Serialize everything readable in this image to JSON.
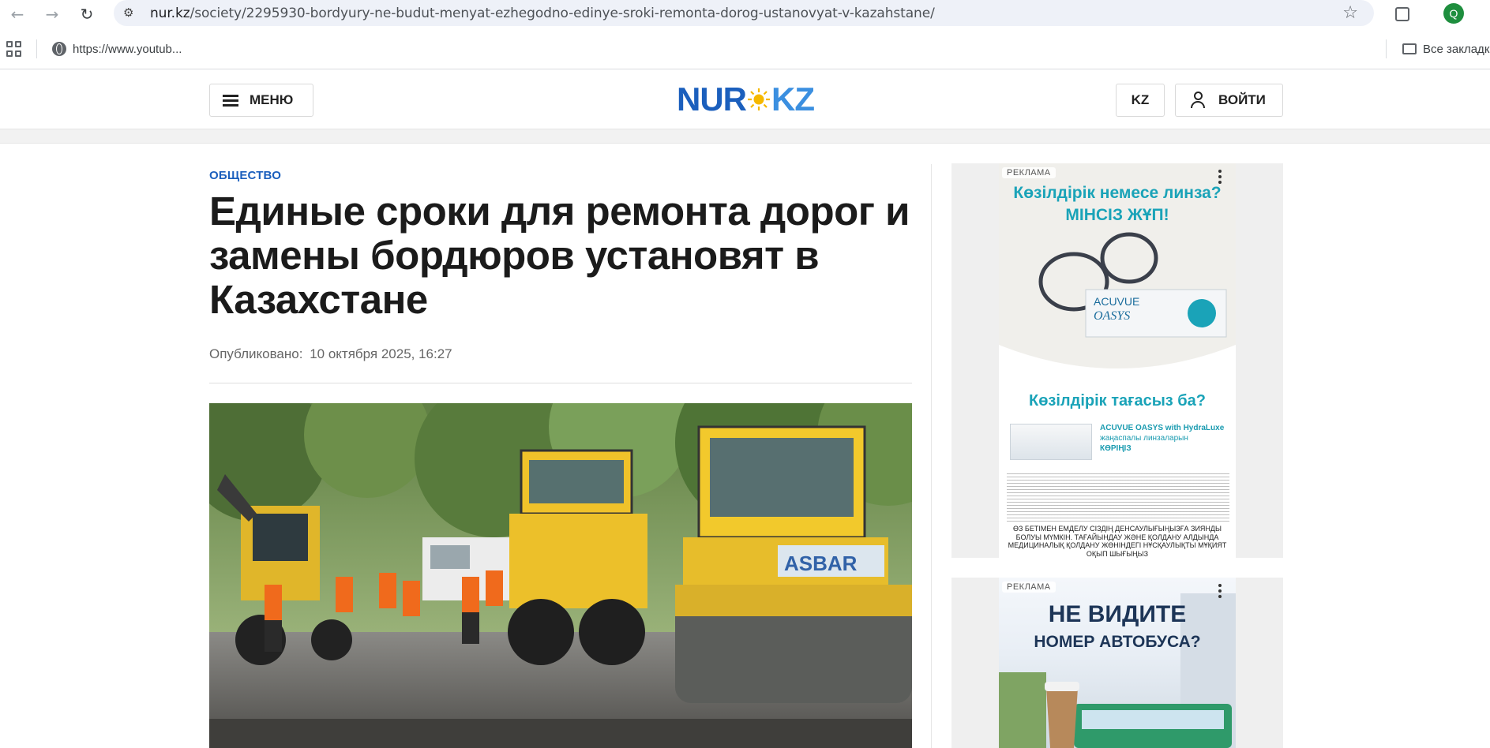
{
  "browser": {
    "url_domain": "nur.kz",
    "url_path": "/society/2295930-bordyury-ne-budut-menyat-ezhegodno-edinye-sroki-remonta-dorog-ustanovyat-v-kazahstane/",
    "profile_initial": "Q",
    "bookmarks": [
      {
        "label": "https://www.youtub..."
      }
    ],
    "all_bookmarks_label": "Все закладк"
  },
  "header": {
    "menu_label": "МЕНЮ",
    "logo_left": "NUR",
    "logo_right": "KZ",
    "lang_label": "KZ",
    "login_label": "ВОЙТИ"
  },
  "article": {
    "category": "ОБЩЕСТВО",
    "title": "Единые сроки для ремонта дорог и замены бордюров установят в Казахстане",
    "published_label": "Опубликовано:",
    "published_date": "10 октября 2025, 16:27",
    "roller_sign": "ASBAR"
  },
  "ads": [
    {
      "tag": "РЕКЛАМА",
      "headline_1": "Көзілдірік немесе линза?",
      "headline_2": "МІНСІЗ ЖҰП!",
      "question": "Көзілдірік тағасыз ба?",
      "product_name": "ACUVUE OASYS with HydraLuxe",
      "product_desc": "жаңаспалы линзаларын",
      "product_cta": "КӨРІҢІЗ",
      "box_brand": "ACUVUE",
      "box_line": "OASYS",
      "warning": "ӨЗ БЕТІМЕН ЕМДЕЛУ СІЗДІҢ ДЕНСАУЛЫҒЫҢЫЗҒА ЗИЯНДЫ БОЛУЫ МҮМКІН. ТАҒАЙЫНДАУ ЖӘНЕ ҚОЛДАНУ АЛДЫНДА МЕДИЦИНАЛЫҚ ҚОЛДАНУ ЖӨНІНДЕГІ НҰСҚАУЛЫҚТЫ МҰҚИЯТ ОҚЫП ШЫҒЫҢЫЗ"
    },
    {
      "tag": "РЕКЛАМА",
      "line_1": "НЕ ВИДИТЕ",
      "line_2": "НОМЕР АВТОБУСА?"
    }
  ],
  "colors": {
    "brand_blue": "#1b5fbd",
    "brand_light_blue": "#3b8fe0",
    "sun_yellow": "#f5b800",
    "ad_teal": "#1aa3b8"
  }
}
